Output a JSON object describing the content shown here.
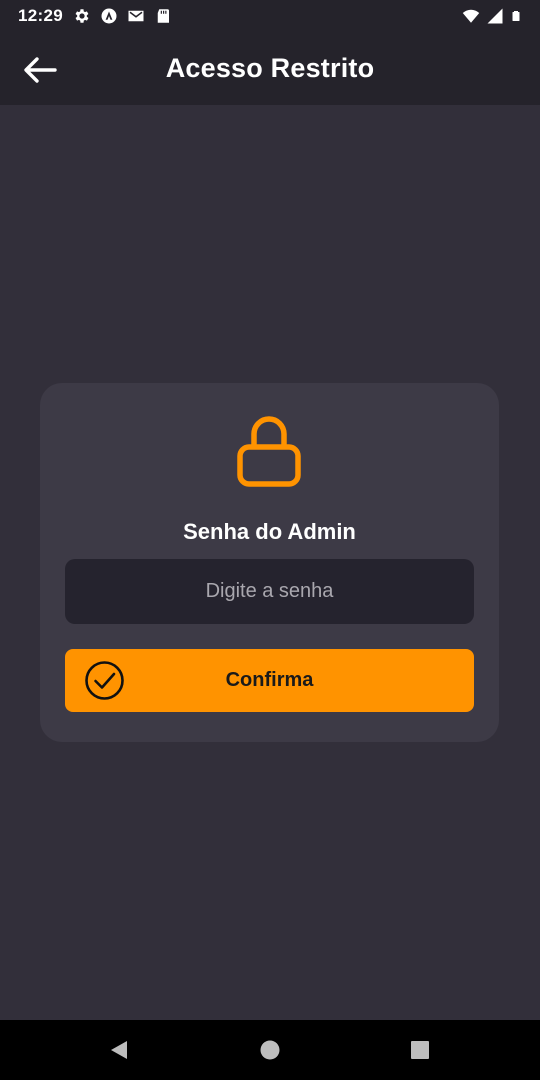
{
  "status_bar": {
    "time": "12:29",
    "left_icons": [
      "gear-icon",
      "app-a-icon",
      "mail-icon",
      "sd-card-icon"
    ],
    "right_icons": [
      "wifi-icon",
      "signal-icon",
      "battery-icon"
    ]
  },
  "app_bar": {
    "title": "Acesso Restrito",
    "back_icon": "arrow-left-icon"
  },
  "card": {
    "icon": "lock-icon",
    "title": "Senha do Admin",
    "password_input": {
      "value": "",
      "placeholder": "Digite a senha"
    },
    "confirm_button": {
      "label": "Confirma",
      "icon": "check-circle-icon"
    }
  },
  "nav_bar": {
    "buttons": [
      "back-triangle-icon",
      "home-circle-icon",
      "recents-square-icon"
    ]
  },
  "colors": {
    "background": "#322f3a",
    "top_bar": "#25232b",
    "card": "#3d3a46",
    "input": "#25232e",
    "accent": "#ff9300"
  }
}
